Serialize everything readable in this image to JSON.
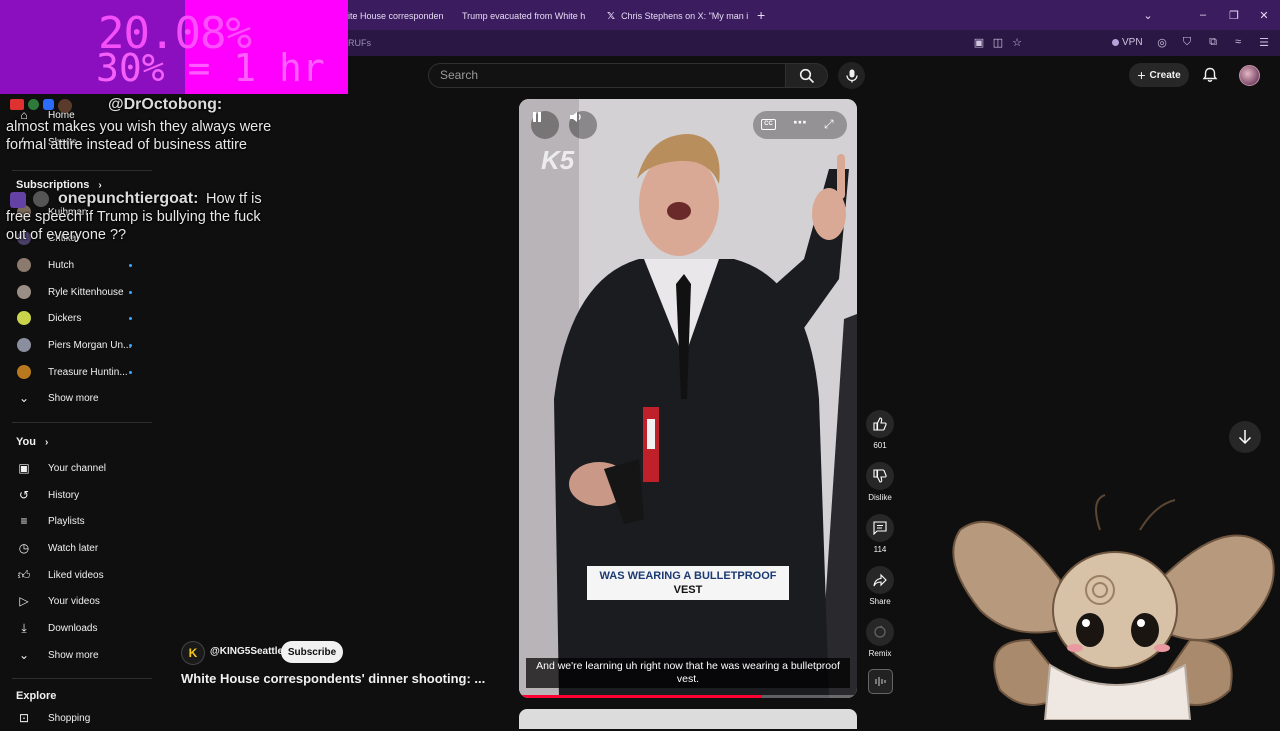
{
  "browser": {
    "tabs": [
      {
        "label": "ite House corresponden"
      },
      {
        "label": "Trump evacuated from White h"
      },
      {
        "label": "Chris Stephens on X: \"My man i"
      }
    ],
    "new_tab": "+",
    "partial_url_text": "RUFs",
    "vpn_label": "VPN"
  },
  "youtube": {
    "search_placeholder": "Search",
    "create_label": "Create"
  },
  "overlay": {
    "timer_line1": "20.08%",
    "timer_line2": "30% = 1 hr",
    "chat": [
      {
        "user": "@DrOctobong:",
        "message": "almost makes you wish they always were formal attire instead of business attire"
      },
      {
        "user": "onepunchtiergoat:",
        "message": "How tf is free speech if Trump is bullying the fuck out of everyone ??"
      }
    ]
  },
  "sidebar": {
    "home": "Home",
    "shorts": "Shorts",
    "subscriptions_heading": "Subscriptions",
    "channels": [
      {
        "name": "Kuihman"
      },
      {
        "name": "Critikal"
      },
      {
        "name": "Hutch"
      },
      {
        "name": "Ryle Kittenhouse"
      },
      {
        "name": "Dickers"
      },
      {
        "name": "Piers Morgan Un..."
      },
      {
        "name": "Treasure Huntin..."
      }
    ],
    "show_more_1": "Show more",
    "you_heading": "You",
    "you_items": [
      {
        "label": "Your channel"
      },
      {
        "label": "History"
      },
      {
        "label": "Playlists"
      },
      {
        "label": "Watch later"
      },
      {
        "label": "Liked videos"
      },
      {
        "label": "Your videos"
      },
      {
        "label": "Downloads"
      }
    ],
    "show_more_2": "Show more",
    "explore_heading": "Explore",
    "explore_first": "Shopping"
  },
  "video": {
    "watermark": "K5",
    "caption_line1": "WAS WEARING A BULLETPROOF",
    "caption_line2": "VEST",
    "subtitle": "And we're learning uh right now that he was wearing a bulletproof vest.",
    "progress_fraction": 0.72,
    "cc_label": "CC",
    "channel_handle": "@KING5Seattle",
    "subscribe_label": "Subscribe",
    "title": "White House correspondents' dinner shooting: ...",
    "actions": {
      "likes": "601",
      "dislike": "Dislike",
      "comments": "114",
      "share": "Share",
      "remix": "Remix"
    }
  }
}
